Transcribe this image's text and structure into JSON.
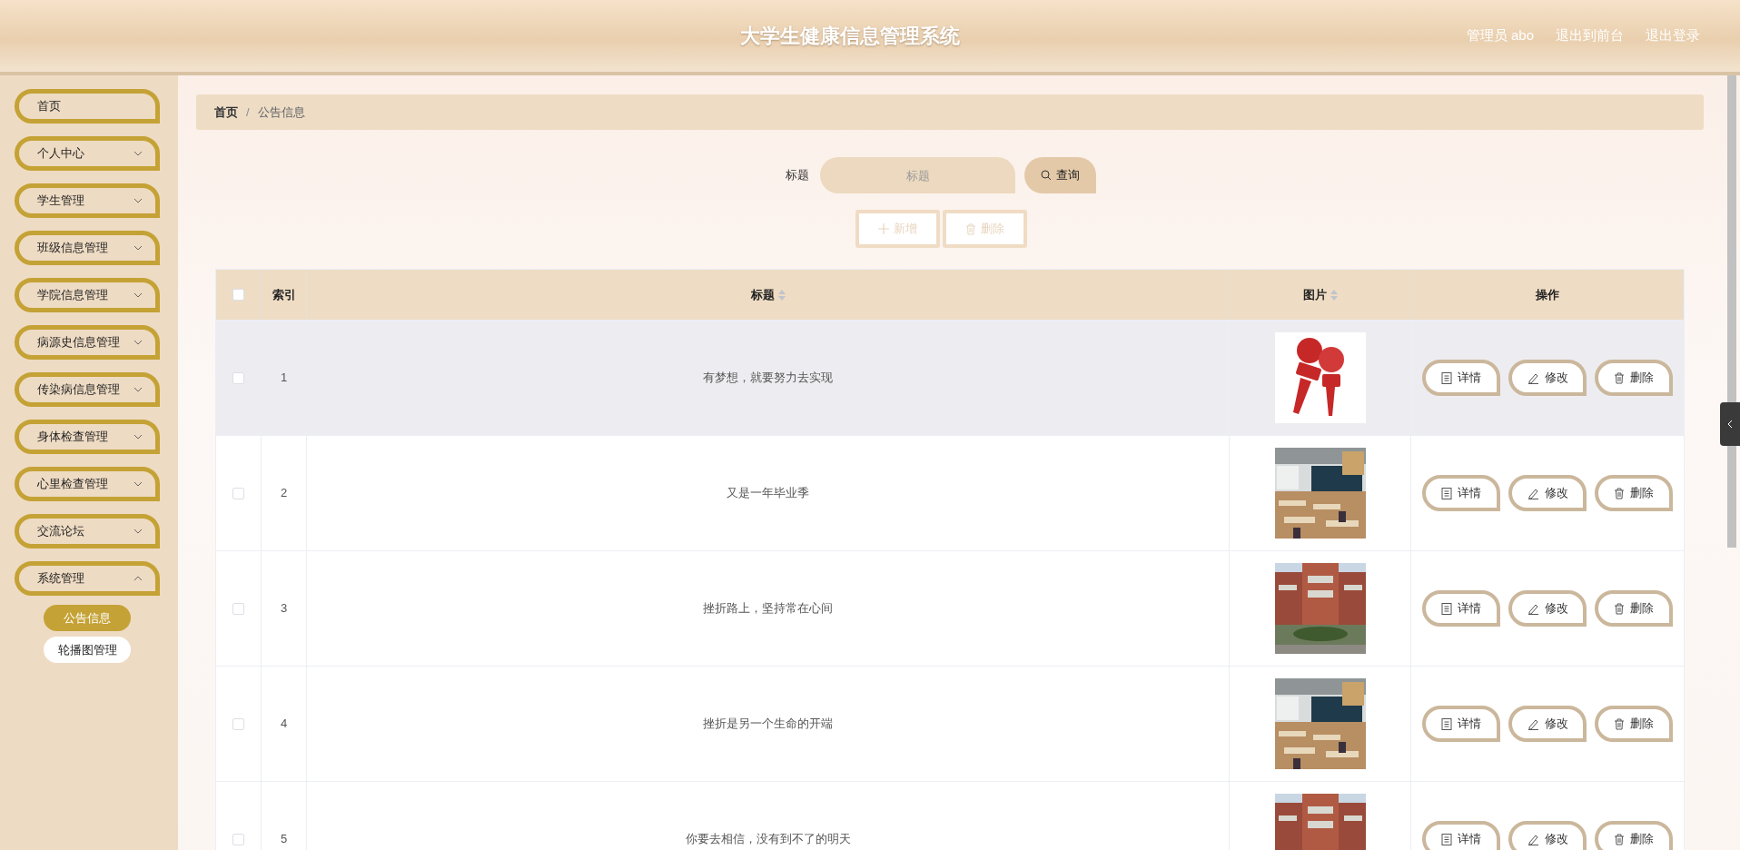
{
  "header": {
    "title": "大学生健康信息管理系统",
    "links": [
      "管理员 abo",
      "退出到前台",
      "退出登录"
    ]
  },
  "sidebar": {
    "items": [
      {
        "label": "首页",
        "kind": "link"
      },
      {
        "label": "个人中心",
        "kind": "menu",
        "expanded": false
      },
      {
        "label": "学生管理",
        "kind": "menu",
        "expanded": false
      },
      {
        "label": "班级信息管理",
        "kind": "menu",
        "expanded": false
      },
      {
        "label": "学院信息管理",
        "kind": "menu",
        "expanded": false
      },
      {
        "label": "病源史信息管理",
        "kind": "menu",
        "expanded": false
      },
      {
        "label": "传染病信息管理",
        "kind": "menu",
        "expanded": false
      },
      {
        "label": "身体检查管理",
        "kind": "menu",
        "expanded": false
      },
      {
        "label": "心里检查管理",
        "kind": "menu",
        "expanded": false
      },
      {
        "label": "交流论坛",
        "kind": "menu",
        "expanded": false
      },
      {
        "label": "系统管理",
        "kind": "menu",
        "expanded": true,
        "children": [
          {
            "label": "公告信息",
            "selected": true
          },
          {
            "label": "轮播图管理",
            "selected": false
          }
        ]
      }
    ]
  },
  "breadcrumb": {
    "separator": "/",
    "items": [
      "首页",
      "公告信息"
    ]
  },
  "search": {
    "label": "标题",
    "placeholder": "标题",
    "button": "查询"
  },
  "actions": [
    {
      "label": "新增",
      "kind": "add"
    },
    {
      "label": "删除",
      "kind": "delete"
    }
  ],
  "table": {
    "select_all": false,
    "columns": [
      {
        "label": "索引",
        "sortable": false
      },
      {
        "label": "标题",
        "sortable": true
      },
      {
        "label": "图片",
        "sortable": true
      },
      {
        "label": "操作",
        "sortable": false
      }
    ],
    "rows": [
      {
        "index": "1",
        "title": "有梦想，就要努力去实现",
        "checked": false,
        "highlighted": true,
        "image": {
          "kind": "picture"
        },
        "buttons": [
          {
            "label": "详情",
            "kind": "detail"
          },
          {
            "label": "修改",
            "kind": "edit"
          },
          {
            "label": "删除",
            "kind": "delete"
          }
        ]
      },
      {
        "index": "2",
        "title": "又是一年毕业季",
        "checked": false,
        "highlighted": false,
        "image": {
          "kind": "picture"
        },
        "buttons": [
          {
            "label": "详情",
            "kind": "detail"
          },
          {
            "label": "修改",
            "kind": "edit"
          },
          {
            "label": "删除",
            "kind": "delete"
          }
        ]
      },
      {
        "index": "3",
        "title": "挫折路上，坚持常在心间",
        "checked": false,
        "highlighted": false,
        "image": {
          "kind": "picture"
        },
        "buttons": [
          {
            "label": "详情",
            "kind": "detail"
          },
          {
            "label": "修改",
            "kind": "edit"
          },
          {
            "label": "删除",
            "kind": "delete"
          }
        ]
      },
      {
        "index": "4",
        "title": "挫折是另一个生命的开端",
        "checked": false,
        "highlighted": false,
        "image": {
          "kind": "picture"
        },
        "buttons": [
          {
            "label": "详情",
            "kind": "detail"
          },
          {
            "label": "修改",
            "kind": "edit"
          },
          {
            "label": "删除",
            "kind": "delete"
          }
        ]
      },
      {
        "index": "5",
        "title": "你要去相信，没有到不了的明天",
        "checked": false,
        "highlighted": false,
        "image": {
          "kind": "picture"
        },
        "buttons": [
          {
            "label": "详情",
            "kind": "detail"
          },
          {
            "label": "修改",
            "kind": "edit"
          },
          {
            "label": "删除",
            "kind": "delete"
          }
        ]
      }
    ]
  }
}
